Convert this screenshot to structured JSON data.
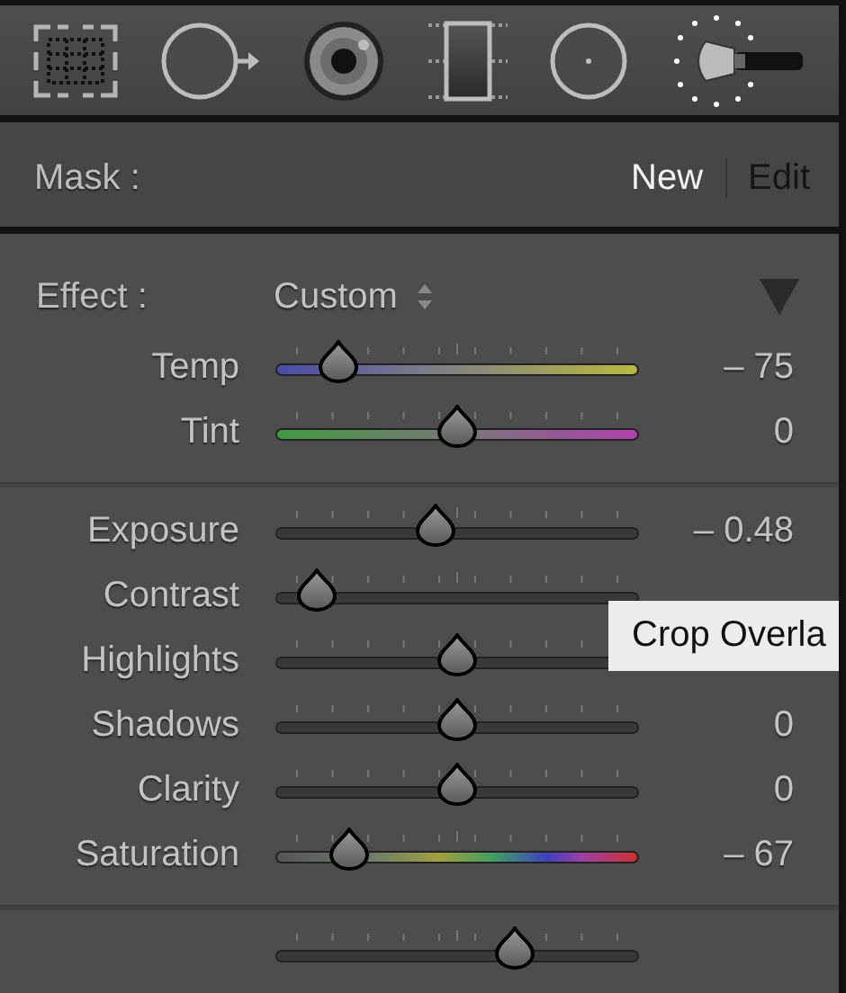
{
  "mask": {
    "label": "Mask :",
    "actions": [
      {
        "label": "New",
        "selected": true
      },
      {
        "label": "Edit",
        "selected": false
      }
    ]
  },
  "effect": {
    "label": "Effect :",
    "value": "Custom"
  },
  "groups": [
    {
      "sliders": [
        {
          "name": "Temp",
          "kind": "temp",
          "level": 0.17,
          "reading": "– 75"
        },
        {
          "name": "Tint",
          "kind": "tint",
          "level": 0.5,
          "reading": "0"
        }
      ]
    },
    {
      "sliders": [
        {
          "name": "Exposure",
          "kind": "plain",
          "level": 0.44,
          "reading": "– 0.48"
        },
        {
          "name": "Contrast",
          "kind": "plain",
          "level": 0.11
        },
        {
          "name": "Highlights",
          "kind": "plain",
          "level": 0.5
        },
        {
          "name": "Shadows",
          "kind": "plain",
          "level": 0.5,
          "reading": "0"
        },
        {
          "name": "Clarity",
          "kind": "plain",
          "level": 0.5,
          "reading": "0"
        },
        {
          "name": "Saturation",
          "kind": "saturation",
          "level": 0.2,
          "reading": "– 67"
        }
      ]
    },
    {
      "sliders": [
        {
          "kind": "plain",
          "level": 0.66
        }
      ]
    }
  ],
  "tooltip": {
    "text": "Crop Overla"
  }
}
